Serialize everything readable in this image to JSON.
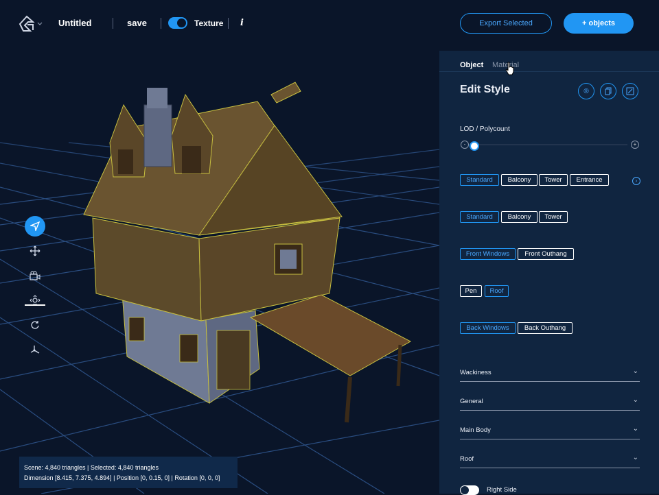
{
  "header": {
    "title": "Untitled",
    "save_label": "save",
    "texture_label": "Texture",
    "info_label": "i",
    "export_label": "Export Selected",
    "add_objects_label": "+ objects"
  },
  "toolbar_tools": [
    "select-tool",
    "move-tool",
    "camera-tool",
    "zoom-tool",
    "rotate-tool",
    "axis-tool"
  ],
  "status": {
    "line1": "Scene: 4,840 triangles | Selected: 4,840 triangles",
    "line2": "Dimension [8.415, 7.375, 4.894] | Position [0, 0.15, 0] | Rotation [0, 0, 0]"
  },
  "panel": {
    "tabs": [
      "Object",
      "Material"
    ],
    "heading": "Edit Style",
    "lod_label": "LOD / Polycount",
    "lod_value": 0.0,
    "chip_rows": [
      [
        "Standard",
        "Balcony",
        "Tower",
        "Entrance"
      ],
      [
        "Standard",
        "Balcony",
        "Tower"
      ],
      [
        "Front Windows",
        "Front Outhang"
      ],
      [
        "Pen",
        "Roof"
      ],
      [
        "Back Windows",
        "Back Outhang"
      ]
    ],
    "accordions": [
      "Wackiness",
      "General",
      "Main Body",
      "Roof"
    ],
    "right_side_label": "Right Side"
  },
  "colors": {
    "background": "#0a1529",
    "panel": "#102540",
    "accent": "#2196f3",
    "roof": "#5c4a2a",
    "walls": "#6f7a94"
  }
}
